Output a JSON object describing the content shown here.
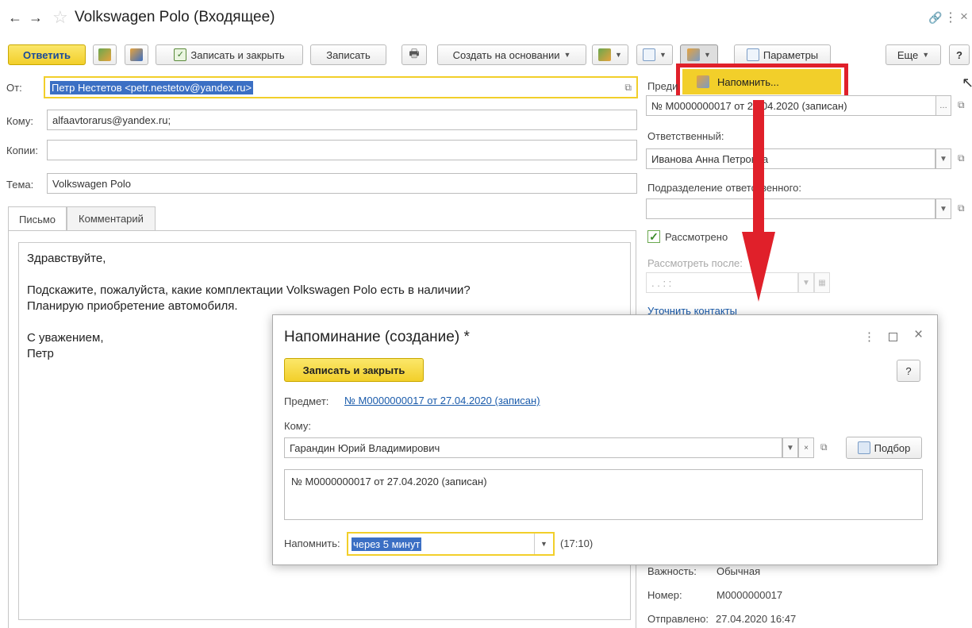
{
  "window": {
    "title": "Volkswagen Polo (Входящее)",
    "more": "⋮",
    "close": "×"
  },
  "toolbar": {
    "reply": "Ответить",
    "save_close": "Записать и закрыть",
    "save": "Записать",
    "create_based": "Создать на основании",
    "params": "Параметры",
    "more": "Еще",
    "help": "?"
  },
  "menu": {
    "remind": "Напомнить..."
  },
  "form": {
    "from_label": "От:",
    "from_value": "Петр Нестетов <petr.nestetov@yandex.ru>",
    "to_label": "Кому:",
    "to_value": "alfaavtorarus@yandex.ru;",
    "cc_label": "Копии:",
    "cc_value": "",
    "subject_label": "Тема:",
    "subject_value": "Volkswagen Polo"
  },
  "tabs": [
    {
      "label": "Письмо"
    },
    {
      "label": "Комментарий"
    }
  ],
  "letter": {
    "line1": "Здравствуйте,",
    "line2": "Подскажите, пожалуйста, какие комплектации Volkswagen Polo есть в наличии?",
    "line3": "Планирую приобретение автомобиля.",
    "line4": "С уважением,",
    "line5": "Петр"
  },
  "right": {
    "subject_label": "Преди",
    "subject_value": "№ М0000000017 от 27.04.2020 (записан)",
    "responsible_label": "Ответственный:",
    "responsible_value": "Иванова Анна Петровна",
    "department_label": "Подразделение ответственного:",
    "department_value": "",
    "reviewed_label": "Рассмотрено",
    "review_after_label": "Рассмотреть после:",
    "review_after_value": ". .   : :",
    "clarify_label": "Уточнить контакты",
    "importance_label": "Важность:",
    "importance_value": "Обычная",
    "number_label": "Номер:",
    "number_value": "М0000000017",
    "sent_label": "Отправлено:",
    "sent_value": "27.04.2020 16:47"
  },
  "dialog": {
    "title": "Напоминание (создание) *",
    "save_close": "Записать и закрыть",
    "help": "?",
    "subject_label": "Предмет:",
    "subject_link": "№ М0000000017 от 27.04.2020 (записан)",
    "to_label": "Кому:",
    "to_value": "Гарандин Юрий Владимирович",
    "pick": "Подбор",
    "text": "№ М0000000017 от 27.04.2020 (записан)",
    "remind_label": "Напомнить:",
    "remind_value": "через 5 минут",
    "remind_time": "(17:10)"
  },
  "colors": {
    "accent_yellow": "#f2cf2a",
    "highlight_red": "#e0202a",
    "selection": "#3b6fc4"
  }
}
